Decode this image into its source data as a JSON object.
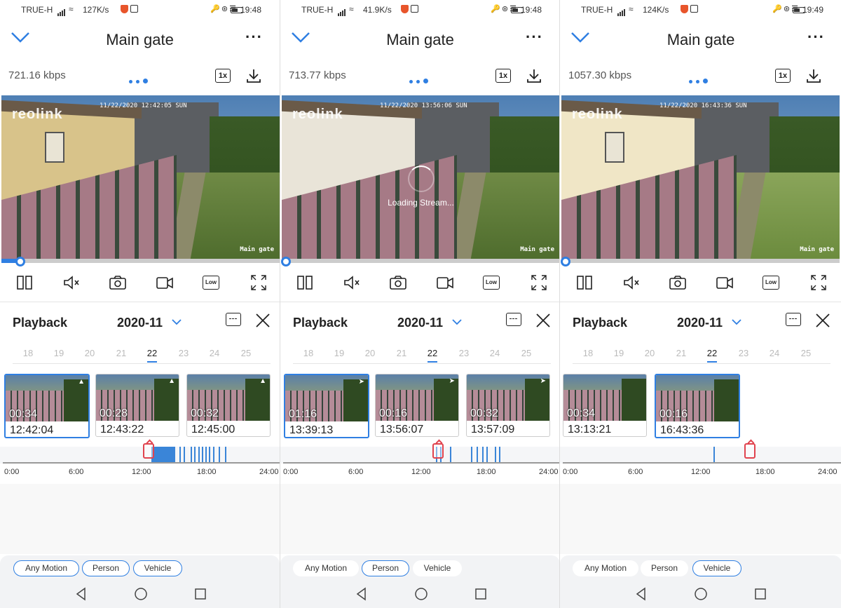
{
  "panels": [
    {
      "status": {
        "carrier": "TRUE-H",
        "net_speed": "127K/s",
        "time": "19:48"
      },
      "header": {
        "title": "Main gate"
      },
      "info": {
        "bitrate": "721.16 kbps",
        "zoom": "1x"
      },
      "video": {
        "logo": "reolink",
        "timestamp": "11/22/2020 12:42:05 SUN",
        "camera_label": "Main gate",
        "loading_text": ""
      },
      "playback": {
        "label": "Playback",
        "month": "2020-11",
        "days": [
          "18",
          "19",
          "20",
          "21",
          "22",
          "23",
          "24",
          "25"
        ],
        "selected_day": "22"
      },
      "clips": [
        {
          "duration": "00:34",
          "time": "12:42:04",
          "selected": true
        },
        {
          "duration": "00:28",
          "time": "12:43:22",
          "selected": false
        },
        {
          "duration": "00:32",
          "time": "12:45:00",
          "selected": false
        }
      ],
      "timeline": {
        "ticks": [
          "0:00",
          "6:00",
          "12:00",
          "18:00",
          "24:00"
        ],
        "marker_hour": 13.2
      },
      "filters": [
        {
          "label": "Any Motion",
          "active": true
        },
        {
          "label": "Person",
          "active": true
        },
        {
          "label": "Vehicle",
          "active": true
        }
      ],
      "toolbar": {
        "quality": "Low"
      }
    },
    {
      "status": {
        "carrier": "TRUE-H",
        "net_speed": "41.9K/s",
        "time": "19:48"
      },
      "header": {
        "title": "Main gate"
      },
      "info": {
        "bitrate": "713.77 kbps",
        "zoom": "1x"
      },
      "video": {
        "logo": "reolink",
        "timestamp": "11/22/2020 13:56:06 SUN",
        "camera_label": "Main gate",
        "loading_text": "Loading Stream..."
      },
      "playback": {
        "label": "Playback",
        "month": "2020-11",
        "days": [
          "18",
          "19",
          "20",
          "21",
          "22",
          "23",
          "24",
          "25"
        ],
        "selected_day": "22"
      },
      "clips": [
        {
          "duration": "01:16",
          "time": "13:39:13",
          "selected": true
        },
        {
          "duration": "00:16",
          "time": "13:56:07",
          "selected": false
        },
        {
          "duration": "00:32",
          "time": "13:57:09",
          "selected": false
        }
      ],
      "timeline": {
        "ticks": [
          "0:00",
          "6:00",
          "12:00",
          "18:00",
          "24:00"
        ],
        "marker_hour": 14.0
      },
      "filters": [
        {
          "label": "Any Motion",
          "active": false
        },
        {
          "label": "Person",
          "active": true
        },
        {
          "label": "Vehicle",
          "active": false
        }
      ],
      "toolbar": {
        "quality": "Low"
      }
    },
    {
      "status": {
        "carrier": "TRUE-H",
        "net_speed": "124K/s",
        "time": "19:49"
      },
      "header": {
        "title": "Main gate"
      },
      "info": {
        "bitrate": "1057.30 kbps",
        "zoom": "1x"
      },
      "video": {
        "logo": "reolink",
        "timestamp": "11/22/2020 16:43:36 SUN",
        "camera_label": "Main gate",
        "loading_text": ""
      },
      "playback": {
        "label": "Playback",
        "month": "2020-11",
        "days": [
          "18",
          "19",
          "20",
          "21",
          "22",
          "23",
          "24",
          "25"
        ],
        "selected_day": "22"
      },
      "clips": [
        {
          "duration": "00:34",
          "time": "13:13:21",
          "selected": false
        },
        {
          "duration": "00:16",
          "time": "16:43:36",
          "selected": true
        }
      ],
      "timeline": {
        "ticks": [
          "0:00",
          "6:00",
          "12:00",
          "18:00",
          "24:00"
        ],
        "marker_hour": 16.7
      },
      "filters": [
        {
          "label": "Any Motion",
          "active": false
        },
        {
          "label": "Person",
          "active": false
        },
        {
          "label": "Vehicle",
          "active": true
        }
      ],
      "toolbar": {
        "quality": "Low"
      }
    }
  ],
  "colors": {
    "accent": "#2f7fe2",
    "marker": "#e0434e",
    "event": "#3a85d8"
  }
}
